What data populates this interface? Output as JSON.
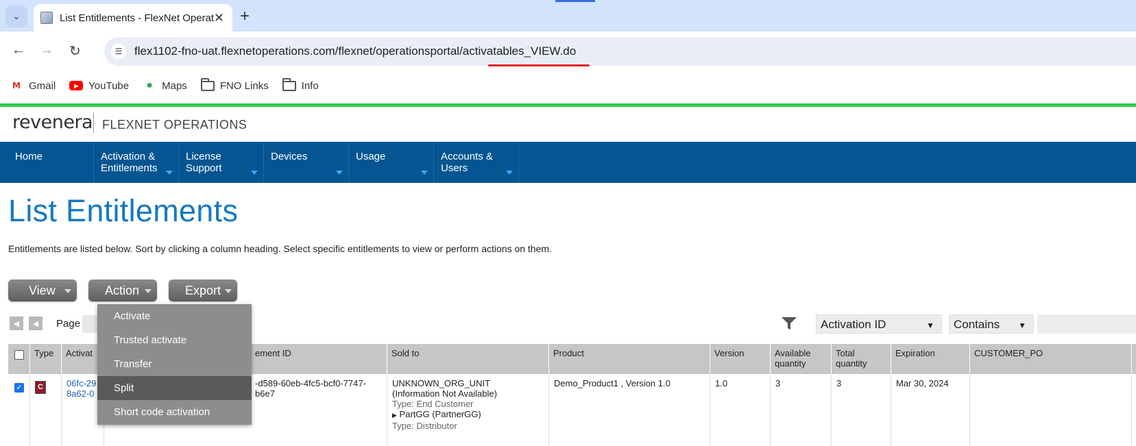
{
  "browser": {
    "tab_title": "List Entitlements - FlexNet Operations",
    "url": "flex1102-fno-uat.flexnetoperations.com/flexnet/operationsportal/activatables_VIEW.do",
    "bookmarks": [
      "Gmail",
      "YouTube",
      "Maps",
      "FNO Links",
      "Info"
    ]
  },
  "header": {
    "logo": "revenera",
    "product": "FLEXNET OPERATIONS"
  },
  "nav": {
    "items": [
      {
        "label": "Home",
        "has_menu": false
      },
      {
        "label": "Activation & Entitlements",
        "has_menu": true
      },
      {
        "label": "License Support",
        "has_menu": true
      },
      {
        "label": "Devices",
        "has_menu": true
      },
      {
        "label": "Usage",
        "has_menu": true
      },
      {
        "label": "Accounts & Users",
        "has_menu": true
      }
    ]
  },
  "page": {
    "title": "List Entitlements",
    "description": "Entitlements are listed below. Sort by clicking a column heading. Select specific entitlements to view or perform actions on them."
  },
  "buttons": {
    "view": "View",
    "action": "Action",
    "export": "Export"
  },
  "pager": {
    "label": "Page"
  },
  "filter": {
    "field": "Activation ID",
    "operator": "Contains"
  },
  "action_menu": {
    "items": [
      "Activate",
      "Trusted activate",
      "Transfer",
      "Split",
      "Short code activation"
    ],
    "selected": "Split"
  },
  "table": {
    "columns": [
      "Type",
      "Activat",
      "ement ID",
      "Sold to",
      "Product",
      "Version",
      "Available quantity",
      "Total quantity",
      "Expiration",
      "CUSTOMER_PO"
    ],
    "rows": [
      {
        "checked": true,
        "type_letter": "C",
        "activation_id_line1": "06fc-29",
        "activation_id_line2": "8a62-0",
        "entitlement_id_line1": "-d589-60eb-4fc5-bcf0-7747-",
        "entitlement_id_line2": "b6e7",
        "sold_to_name": "UNKNOWN_ORG_UNIT",
        "sold_to_info": "(Information Not Available)",
        "sold_to_type": "Type: End Customer",
        "partner": "PartGG (PartnerGG)",
        "partner_type": "Type: Distributor",
        "product": "Demo_Product1 , Version 1.0",
        "version": "1.0",
        "available_quantity": "3",
        "total_quantity": "3",
        "expiration": "Mar 30, 2024",
        "customer_po": ""
      }
    ]
  },
  "colors": {
    "nav_bg": "#045591",
    "title_blue": "#1578c3",
    "accent_green": "#2ecc4a",
    "highlight_red": "#e01a22"
  }
}
